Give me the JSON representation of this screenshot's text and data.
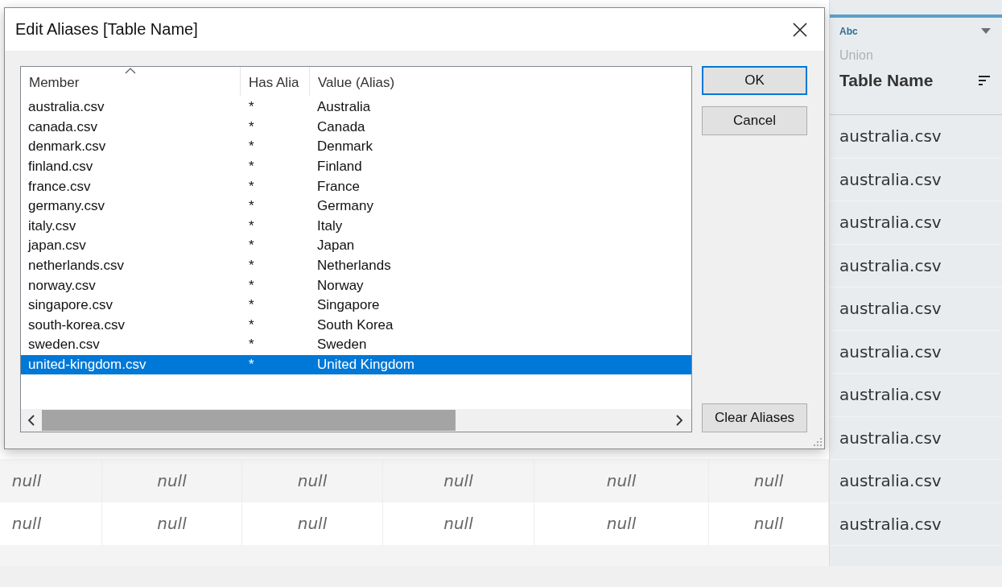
{
  "table_name_column": {
    "type_label": "Abc",
    "source": "Union",
    "title": "Table Name",
    "cells": [
      "australia.csv",
      "australia.csv",
      "australia.csv",
      "australia.csv",
      "australia.csv",
      "australia.csv",
      "australia.csv",
      "australia.csv",
      "australia.csv",
      "australia.csv"
    ]
  },
  "null_rows": [
    [
      "null",
      "null",
      "null",
      "null",
      "null",
      "null"
    ],
    [
      "null",
      "null",
      "null",
      "null",
      "null",
      "null"
    ]
  ],
  "dialog": {
    "title": "Edit Aliases [Table Name]",
    "columns": [
      {
        "label": "Member",
        "sorted": true
      },
      {
        "label": "Has Alia",
        "sorted": false
      },
      {
        "label": "Value (Alias)",
        "sorted": false
      }
    ],
    "rows": [
      {
        "member": "australia.csv",
        "has_alias": "*",
        "alias": "Australia",
        "selected": false
      },
      {
        "member": "canada.csv",
        "has_alias": "*",
        "alias": "Canada",
        "selected": false
      },
      {
        "member": "denmark.csv",
        "has_alias": "*",
        "alias": "Denmark",
        "selected": false
      },
      {
        "member": "finland.csv",
        "has_alias": "*",
        "alias": "Finland",
        "selected": false
      },
      {
        "member": "france.csv",
        "has_alias": "*",
        "alias": "France",
        "selected": false
      },
      {
        "member": "germany.csv",
        "has_alias": "*",
        "alias": "Germany",
        "selected": false
      },
      {
        "member": "italy.csv",
        "has_alias": "*",
        "alias": "Italy",
        "selected": false
      },
      {
        "member": "japan.csv",
        "has_alias": "*",
        "alias": "Japan",
        "selected": false
      },
      {
        "member": "netherlands.csv",
        "has_alias": "*",
        "alias": "Netherlands",
        "selected": false
      },
      {
        "member": "norway.csv",
        "has_alias": "*",
        "alias": "Norway",
        "selected": false
      },
      {
        "member": "singapore.csv",
        "has_alias": "*",
        "alias": "Singapore",
        "selected": false
      },
      {
        "member": "south-korea.csv",
        "has_alias": "*",
        "alias": "South Korea",
        "selected": false
      },
      {
        "member": "sweden.csv",
        "has_alias": "*",
        "alias": "Sweden",
        "selected": false
      },
      {
        "member": "united-kingdom.csv",
        "has_alias": "*",
        "alias": "United Kingdom",
        "selected": true
      }
    ],
    "buttons": [
      {
        "label": "OK",
        "default": true
      },
      {
        "label": "Cancel",
        "default": false
      }
    ],
    "clear_button": "Clear Aliases"
  }
}
